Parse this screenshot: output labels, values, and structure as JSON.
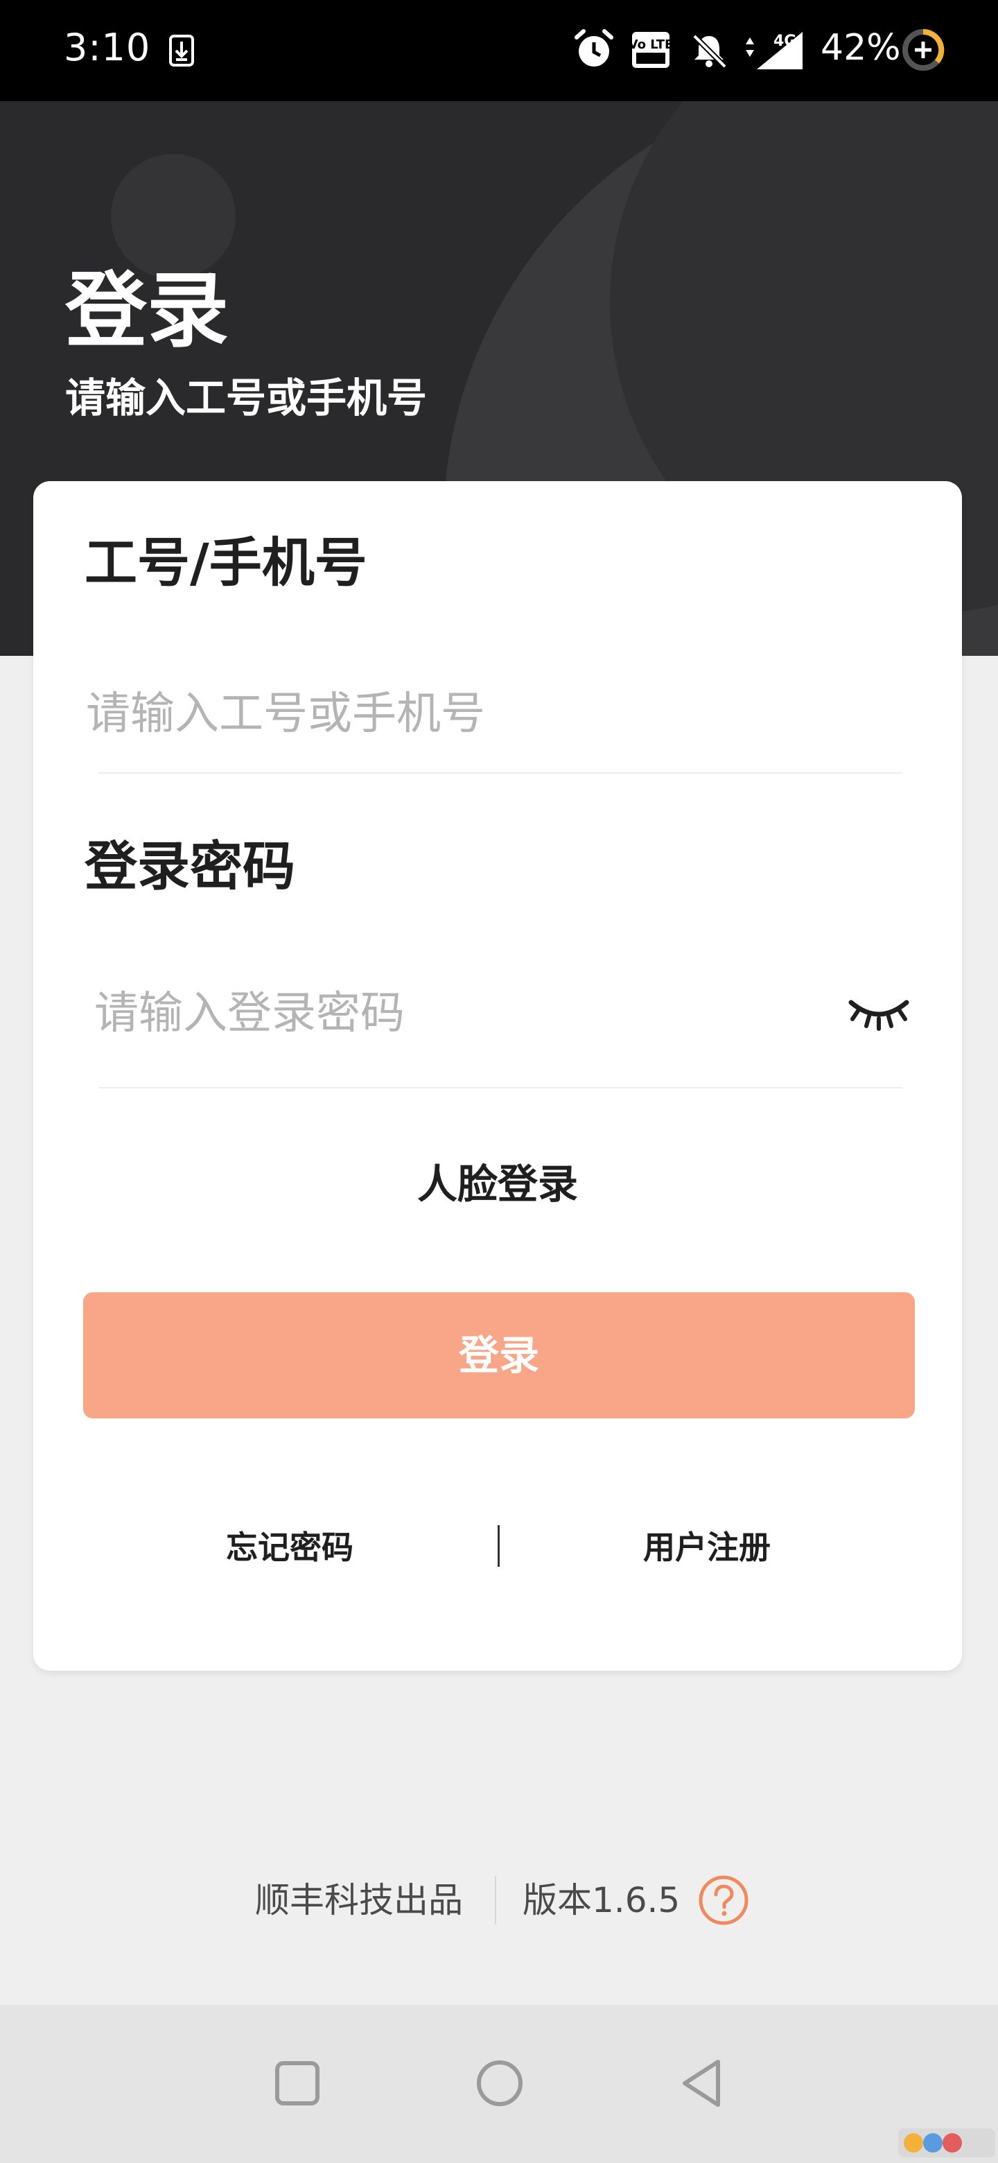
{
  "status_bar": {
    "time": "3:10",
    "battery_percent": "42%",
    "icons": [
      "download-icon",
      "alarm-icon",
      "volte-icon",
      "mute-bell-icon",
      "signal-4g-icon",
      "battery-charging-icon"
    ],
    "network_label": "4G",
    "volte_label": "Vo LTE"
  },
  "header": {
    "title": "登录",
    "subtitle": "请输入工号或手机号",
    "background_color": "#2a2a2c"
  },
  "form": {
    "account_label": "工号/手机号",
    "account_placeholder": "请输入工号或手机号",
    "account_value": "",
    "password_label": "登录密码",
    "password_placeholder": "请输入登录密码",
    "password_value": "",
    "password_visibility_icon": "eye-closed-icon",
    "face_login_label": "人脸登录",
    "login_button_label": "登录",
    "login_button_color": "#f9a587",
    "forgot_password_label": "忘记密码",
    "register_label": "用户注册"
  },
  "footer": {
    "company": "顺丰科技出品",
    "version": "版本1.6.5",
    "help_icon": "question-circle-icon",
    "accent_color": "#f08a5d"
  },
  "nav_bar": {
    "buttons": [
      "recent-apps-icon",
      "home-icon",
      "back-icon"
    ]
  }
}
